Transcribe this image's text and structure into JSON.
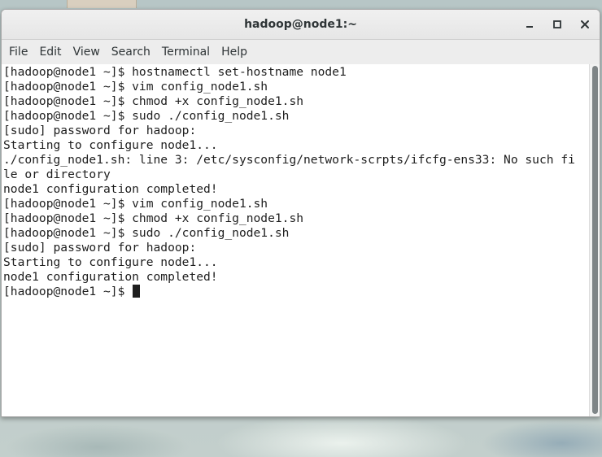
{
  "window": {
    "title": "hadoop@node1:~"
  },
  "menubar": {
    "items": [
      "File",
      "Edit",
      "View",
      "Search",
      "Terminal",
      "Help"
    ]
  },
  "terminal": {
    "lines": [
      "[hadoop@node1 ~]$ hostnamectl set-hostname node1",
      "[hadoop@node1 ~]$ vim config_node1.sh",
      "[hadoop@node1 ~]$ chmod +x config_node1.sh",
      "[hadoop@node1 ~]$ sudo ./config_node1.sh",
      "[sudo] password for hadoop:",
      "Starting to configure node1...",
      "./config_node1.sh: line 3: /etc/sysconfig/network-scrpts/ifcfg-ens33: No such fi",
      "le or directory",
      "node1 configuration completed!",
      "[hadoop@node1 ~]$ vim config_node1.sh",
      "[hadoop@node1 ~]$ chmod +x config_node1.sh",
      "[hadoop@node1 ~]$ sudo ./config_node1.sh",
      "[sudo] password for hadoop:",
      "Starting to configure node1...",
      "node1 configuration completed!"
    ],
    "prompt": "[hadoop@node1 ~]$ "
  },
  "icons": {
    "minimize": "minimize-icon",
    "maximize": "maximize-icon",
    "close": "close-icon"
  }
}
